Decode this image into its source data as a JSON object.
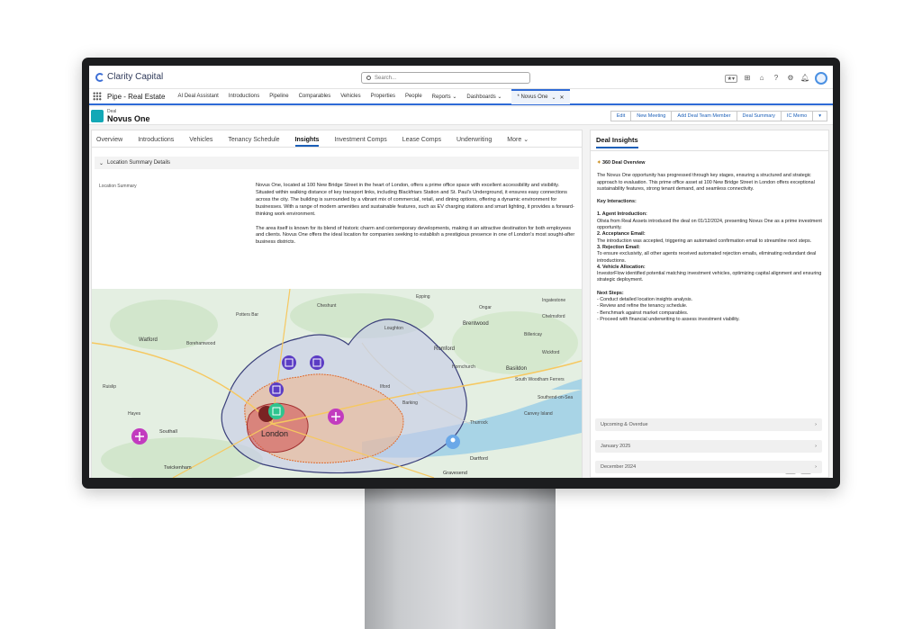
{
  "app": {
    "logo_text": "Clarity Capital",
    "search_placeholder": "Search...",
    "app_name": "Pipe - Real Estate"
  },
  "nav": {
    "items": [
      "AI Deal Assistant",
      "Introductions",
      "Pipeline",
      "Comparables",
      "Vehicles",
      "Properties",
      "People",
      "Reports",
      "Dashboards"
    ],
    "active_tab": "* Novus One"
  },
  "record": {
    "type": "Deal",
    "name": "Novus One",
    "actions": [
      "Edit",
      "New Meeting",
      "Add Deal Team Member",
      "Deal Summary",
      "IC Memo"
    ]
  },
  "tabs": [
    "Overview",
    "Introductions",
    "Vehicles",
    "Tenancy Schedule",
    "Insights",
    "Investment Comps",
    "Lease Comps",
    "Underwriting",
    "More"
  ],
  "active_tab": "Insights",
  "section": {
    "title": "Location Summary Details",
    "field_label": "Location Summary",
    "paragraphs": [
      "Novus One, located at 100 New Bridge Street in the heart of London, offers a prime office space with excellent accessibility and visibility. Situated within walking distance of key transport links, including Blackfriars Station and St. Paul's Underground, it ensures easy connections across the city. The building is surrounded by a vibrant mix of commercial, retail, and dining options, offering a dynamic environment for businesses. With a range of modern amenities and sustainable features, such as EV charging stations and smart lighting, it provides a forward-thinking work environment.",
      "The area itself is known for its blend of historic charm and contemporary developments, making it an attractive destination for both employees and clients. Novus One offers the ideal location for companies seeking to establish a prestigious presence in one of London's most sought-after business districts."
    ]
  },
  "map": {
    "places": [
      "Watford",
      "Borehamwood",
      "Potters Bar",
      "Cheshunt",
      "Epping",
      "Ingatestone",
      "Ongar",
      "Loughton",
      "Brentwood",
      "Billericay",
      "Wickford",
      "Romford",
      "Basildon",
      "South Woodham Ferrers",
      "Hornchurch",
      "Ilford",
      "Barking",
      "London",
      "Southall",
      "Twickenham",
      "Dartford",
      "Gravesend",
      "Thurrock",
      "Canvey Island",
      "Southend-on-Sea",
      "Chelmsford",
      "Hayes",
      "Ruislip"
    ]
  },
  "insights": {
    "title": "Deal Insights",
    "overview_heading": "360 Deal Overview",
    "overview_text": "The Novus One opportunity has progressed through key stages, ensuring a structured and strategic approach to evaluation. This prime office asset at 100 New Bridge Street in London offers exceptional sustainability features, strong tenant demand, and seamless connectivity.",
    "key_heading": "Key Interactions:",
    "interactions": [
      {
        "title": "1. Agent Introduction:",
        "text": "Olivia from Real Assets introduced the deal on 01/12/2024, presenting Novus One as a prime investment opportunity."
      },
      {
        "title": "2. Acceptance Email:",
        "text": "The introduction was accepted, triggering an automated confirmation email to streamline next steps."
      },
      {
        "title": "3. Rejection Email:",
        "text": "To ensure exclusivity, all other agents received automated rejection emails, eliminating redundant deal introductions."
      },
      {
        "title": "4. Vehicle Allocation:",
        "text": "InvestorFlow identified potential matching investment vehicles, optimizing capital alignment and ensuring strategic deployment."
      }
    ],
    "next_heading": "Next Steps:",
    "next_steps": [
      "- Conduct detailed location insights analysis.",
      "- Review and refine the tenancy schedule.",
      "- Benchmark against market comparables.",
      "- Proceed with financial underwriting to assess investment viability."
    ],
    "accordions": [
      "Upcoming & Overdue",
      "January 2025",
      "December 2024"
    ]
  },
  "colors": {
    "accent": "#1b5fb8",
    "nav_border": "#2e6ad6",
    "record_icon": "#13a8b6",
    "map_water": "#a8d4e6",
    "map_land": "#e4efe2",
    "marker_purple": "#5b3cc4",
    "marker_magenta": "#c23bbf"
  }
}
